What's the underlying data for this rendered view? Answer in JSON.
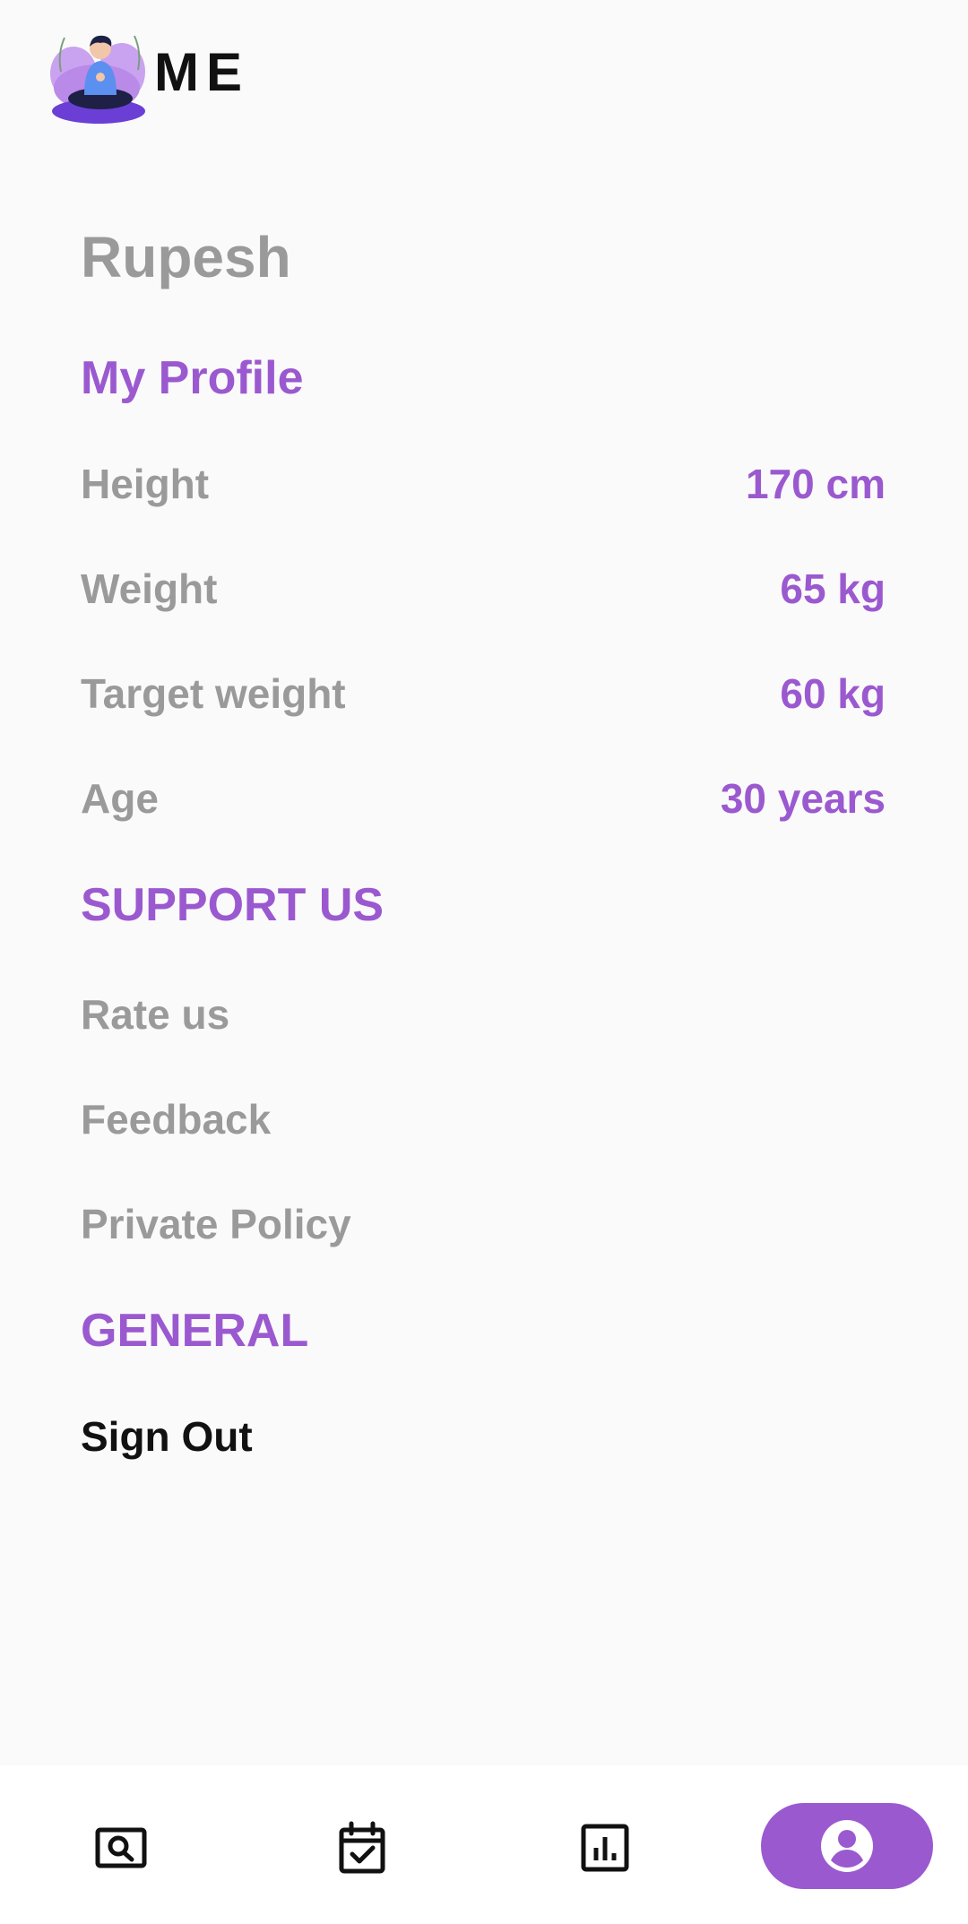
{
  "header": {
    "title": "ME",
    "logo_icon": "meditation-avatar-icon"
  },
  "profile": {
    "name": "Rupesh",
    "section_title": "My Profile",
    "rows": [
      {
        "label": "Height",
        "value": "170 cm"
      },
      {
        "label": "Weight",
        "value": "65 kg"
      },
      {
        "label": "Target weight",
        "value": "60 kg"
      },
      {
        "label": "Age",
        "value": "30 years"
      }
    ]
  },
  "support": {
    "section_title": "SUPPORT US",
    "items": [
      "Rate us",
      "Feedback",
      "Private Policy"
    ]
  },
  "general": {
    "section_title": "GENERAL",
    "sign_out": "Sign Out"
  },
  "bottom_nav": {
    "items": [
      {
        "icon": "search-icon",
        "active": false
      },
      {
        "icon": "calendar-check-icon",
        "active": false
      },
      {
        "icon": "bar-chart-icon",
        "active": false
      },
      {
        "icon": "profile-icon",
        "active": true
      }
    ]
  },
  "colors": {
    "accent": "#9b59d0",
    "muted_text": "#9a9a9a",
    "background": "#fafafa"
  }
}
